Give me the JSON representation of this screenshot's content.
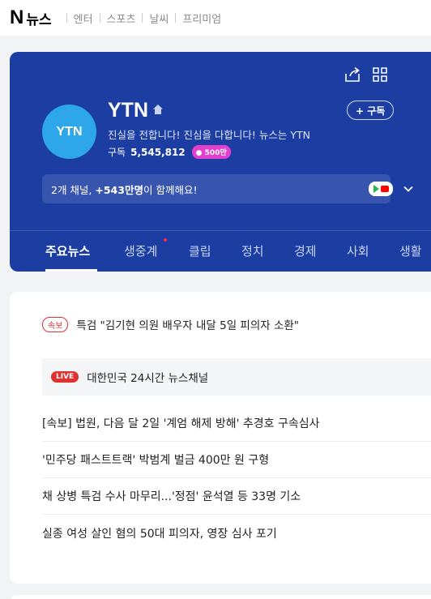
{
  "nav": {
    "logo_letter": "N",
    "logo_text": "뉴스",
    "links": [
      "엔터",
      "스포츠",
      "날씨",
      "프리미엄"
    ]
  },
  "channel": {
    "name": "YTN",
    "avatar_text": "YTN",
    "description": "진실을 전합니다! 진심을 다합니다! 뉴스는 YTN",
    "subscribers_label": "구독",
    "subscribers_count": "5,545,812",
    "badge": "500만",
    "subscribe_button": "+ 구독",
    "share_icon": "share-icon",
    "grid_icon": "grid-icon",
    "promo": {
      "channels": "2개 채널,",
      "audience": "+543만명",
      "suffix": "이 함께해요!"
    },
    "tabs": [
      "주요뉴스",
      "생중계",
      "클립",
      "정치",
      "경제",
      "사회",
      "생활"
    ],
    "active_tab": 0
  },
  "news": {
    "breaking_tag": "속보",
    "breaking_headline": "특검 \"김기현 의원 배우자 내달 5일 피의자 소환\"",
    "live_tag": "LIVE",
    "live_title": "대한민국 24시간 뉴스채널",
    "headlines": [
      "[속보] 법원, 다음 달 2일 '계엄 해제 방해' 추경호 구속심사",
      "'민주당 패스트트랙' 박범계 벌금 400만 원 구형",
      "채 상병 특검 수사 마무리...'정점' 윤석열 등 33명 기소",
      "실종 여성 살인 혐의 50대 피의자, 영장 심사 포기"
    ]
  },
  "colors": {
    "card_bg": "#1c3ea3",
    "avatar_bg": "#2ea7ea",
    "live_red": "#e03131",
    "badge_pink": "#e23fcf"
  }
}
